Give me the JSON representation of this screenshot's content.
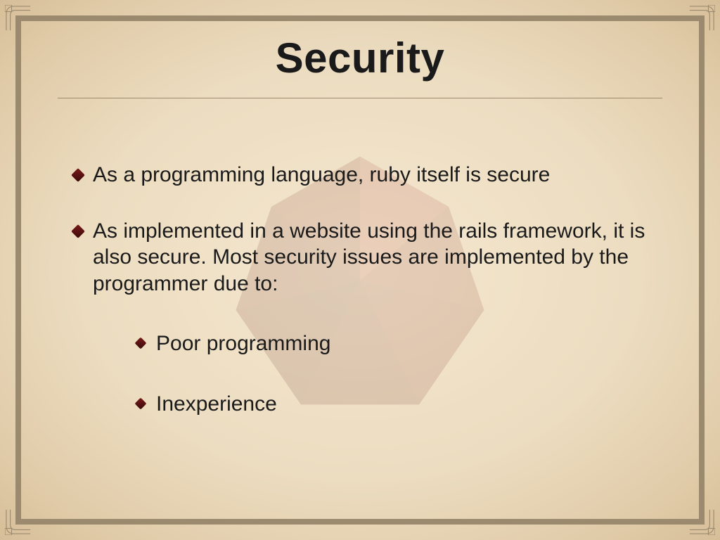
{
  "title": "Security",
  "bullets": [
    "As a programming language, ruby itself is secure",
    "As implemented in a website using the rails framework, it is also secure.  Most security issues are implemented by the programmer due to:"
  ],
  "sub_bullets": [
    "Poor programming",
    "Inexperience"
  ]
}
